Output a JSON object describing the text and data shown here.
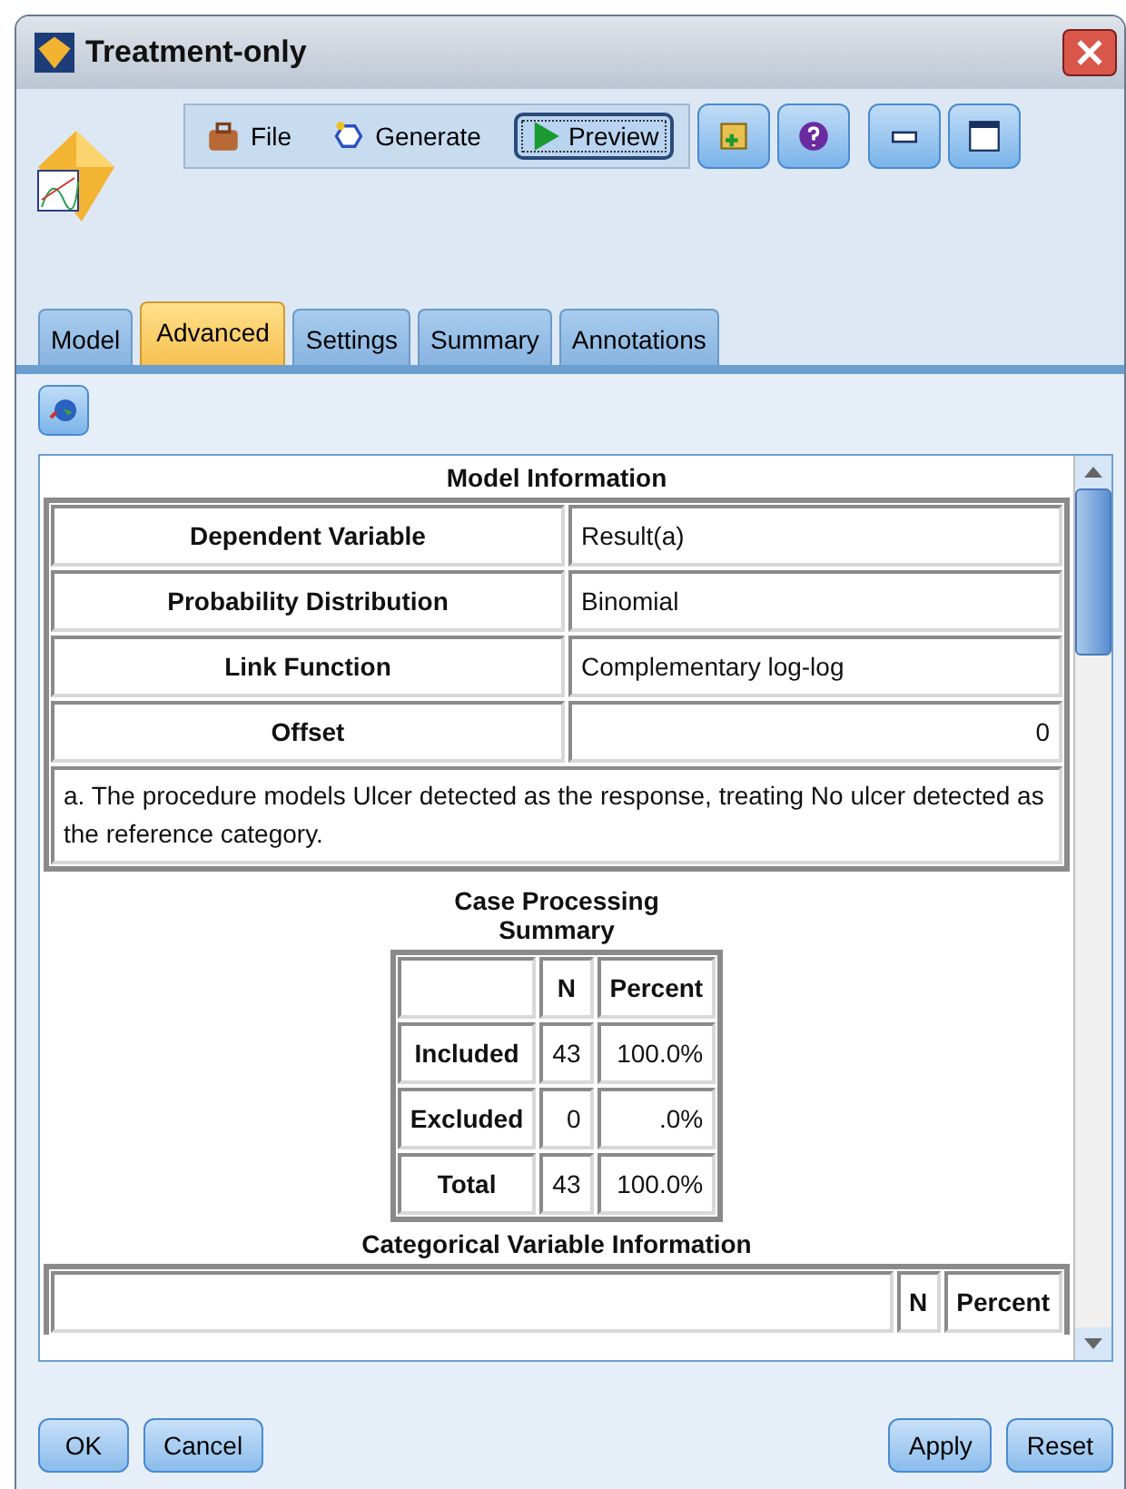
{
  "window": {
    "title": "Treatment-only"
  },
  "toolbar": {
    "items": [
      {
        "label": "File",
        "kind": "menu"
      },
      {
        "label": "Generate",
        "kind": "menu"
      },
      {
        "label": "Preview",
        "kind": "button"
      }
    ]
  },
  "tabs": [
    {
      "label": "Model",
      "selected": false
    },
    {
      "label": "Advanced",
      "selected": true
    },
    {
      "label": "Settings",
      "selected": false
    },
    {
      "label": "Summary",
      "selected": false
    },
    {
      "label": "Annotations",
      "selected": false
    }
  ],
  "model_information": {
    "title": "Model Information",
    "rows": [
      {
        "label": "Dependent Variable",
        "value": "Result(a)",
        "numeric": false
      },
      {
        "label": "Probability Distribution",
        "value": "Binomial",
        "numeric": false
      },
      {
        "label": "Link Function",
        "value": "Complementary log-log",
        "numeric": false
      },
      {
        "label": "Offset",
        "value": "0",
        "numeric": true
      }
    ],
    "footnote": "a. The procedure models Ulcer detected as the response, treating No ulcer detected as the reference category."
  },
  "case_processing": {
    "title": "Case Processing Summary",
    "columns": [
      "N",
      "Percent"
    ],
    "rows": [
      {
        "label": "Included",
        "n": "43",
        "percent": "100.0%"
      },
      {
        "label": "Excluded",
        "n": "0",
        "percent": ".0%"
      },
      {
        "label": "Total",
        "n": "43",
        "percent": "100.0%"
      }
    ]
  },
  "categorical": {
    "title": "Categorical Variable Information",
    "columns": [
      "N",
      "Percent"
    ]
  },
  "buttons_left": [
    "OK",
    "Cancel"
  ],
  "buttons_right": [
    "Apply",
    "Reset"
  ]
}
